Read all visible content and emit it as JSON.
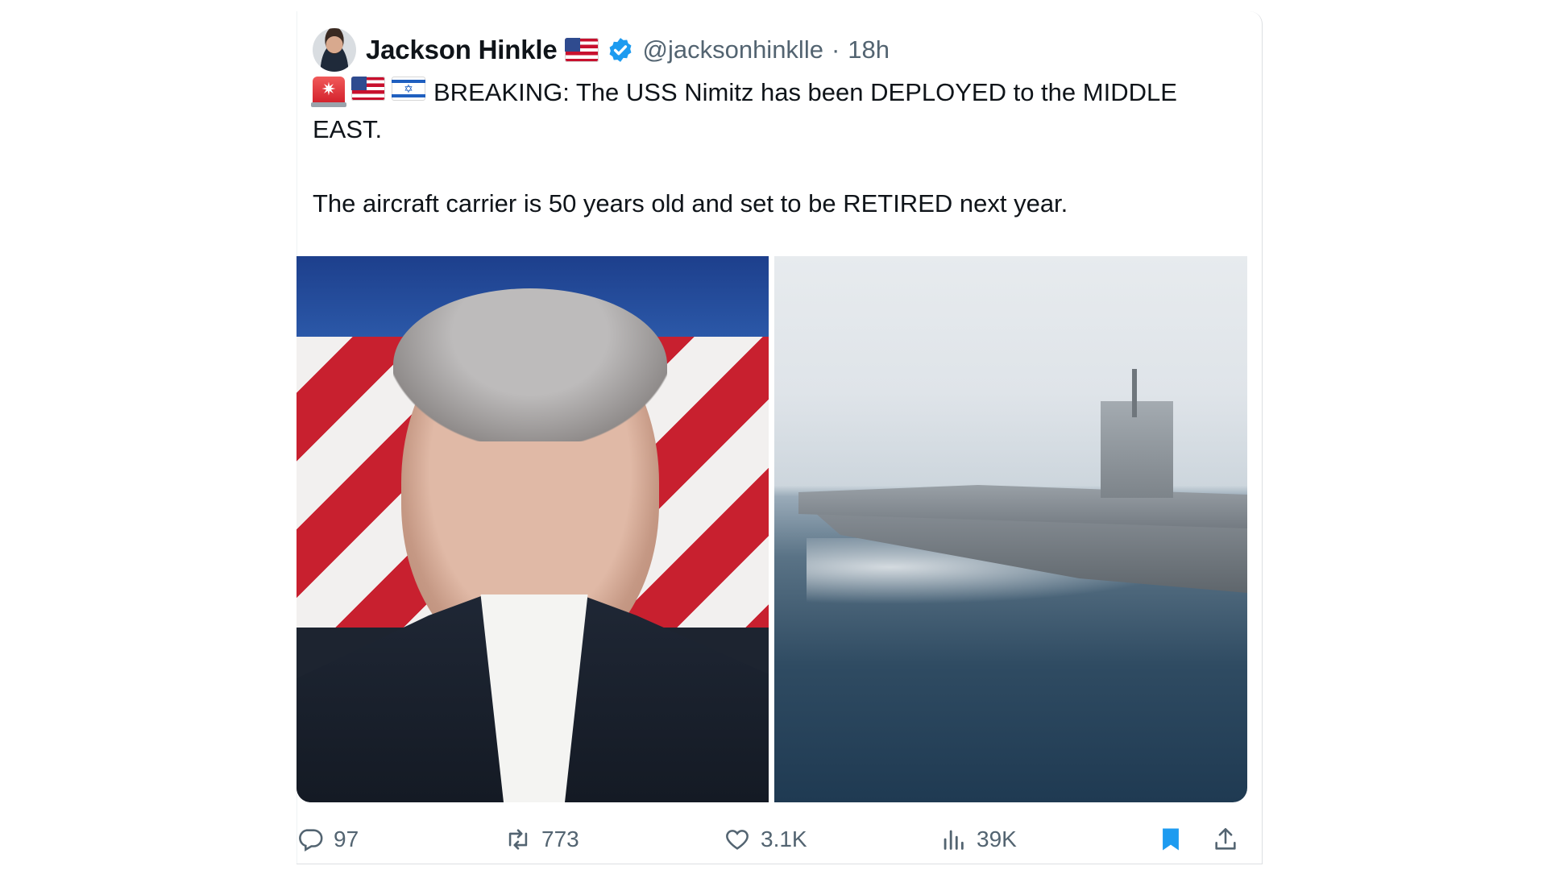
{
  "tweet": {
    "author_name": "Jackson Hinkle",
    "handle": "@jacksonhinklle",
    "separator": "·",
    "time": "18h",
    "text_line1": "BREAKING: The USS Nimitz has been DEPLOYED to the MIDDLE EAST.",
    "text_line2": "The aircraft carrier is 50 years old and set to be RETIRED next year.",
    "emojis": [
      "siren-icon",
      "us-flag-icon",
      "israel-flag-icon"
    ],
    "media": [
      {
        "kind": "photo",
        "name": "portrait-photo"
      },
      {
        "kind": "photo",
        "name": "aircraft-carrier-photo"
      }
    ]
  },
  "actions": {
    "reply_count": "97",
    "retweet_count": "773",
    "like_count": "3.1K",
    "views_count": "39K"
  },
  "colors": {
    "text": "#0f1419",
    "muted": "#536471",
    "verified": "#1d9bf0",
    "bookmark": "#1d9bf0"
  }
}
